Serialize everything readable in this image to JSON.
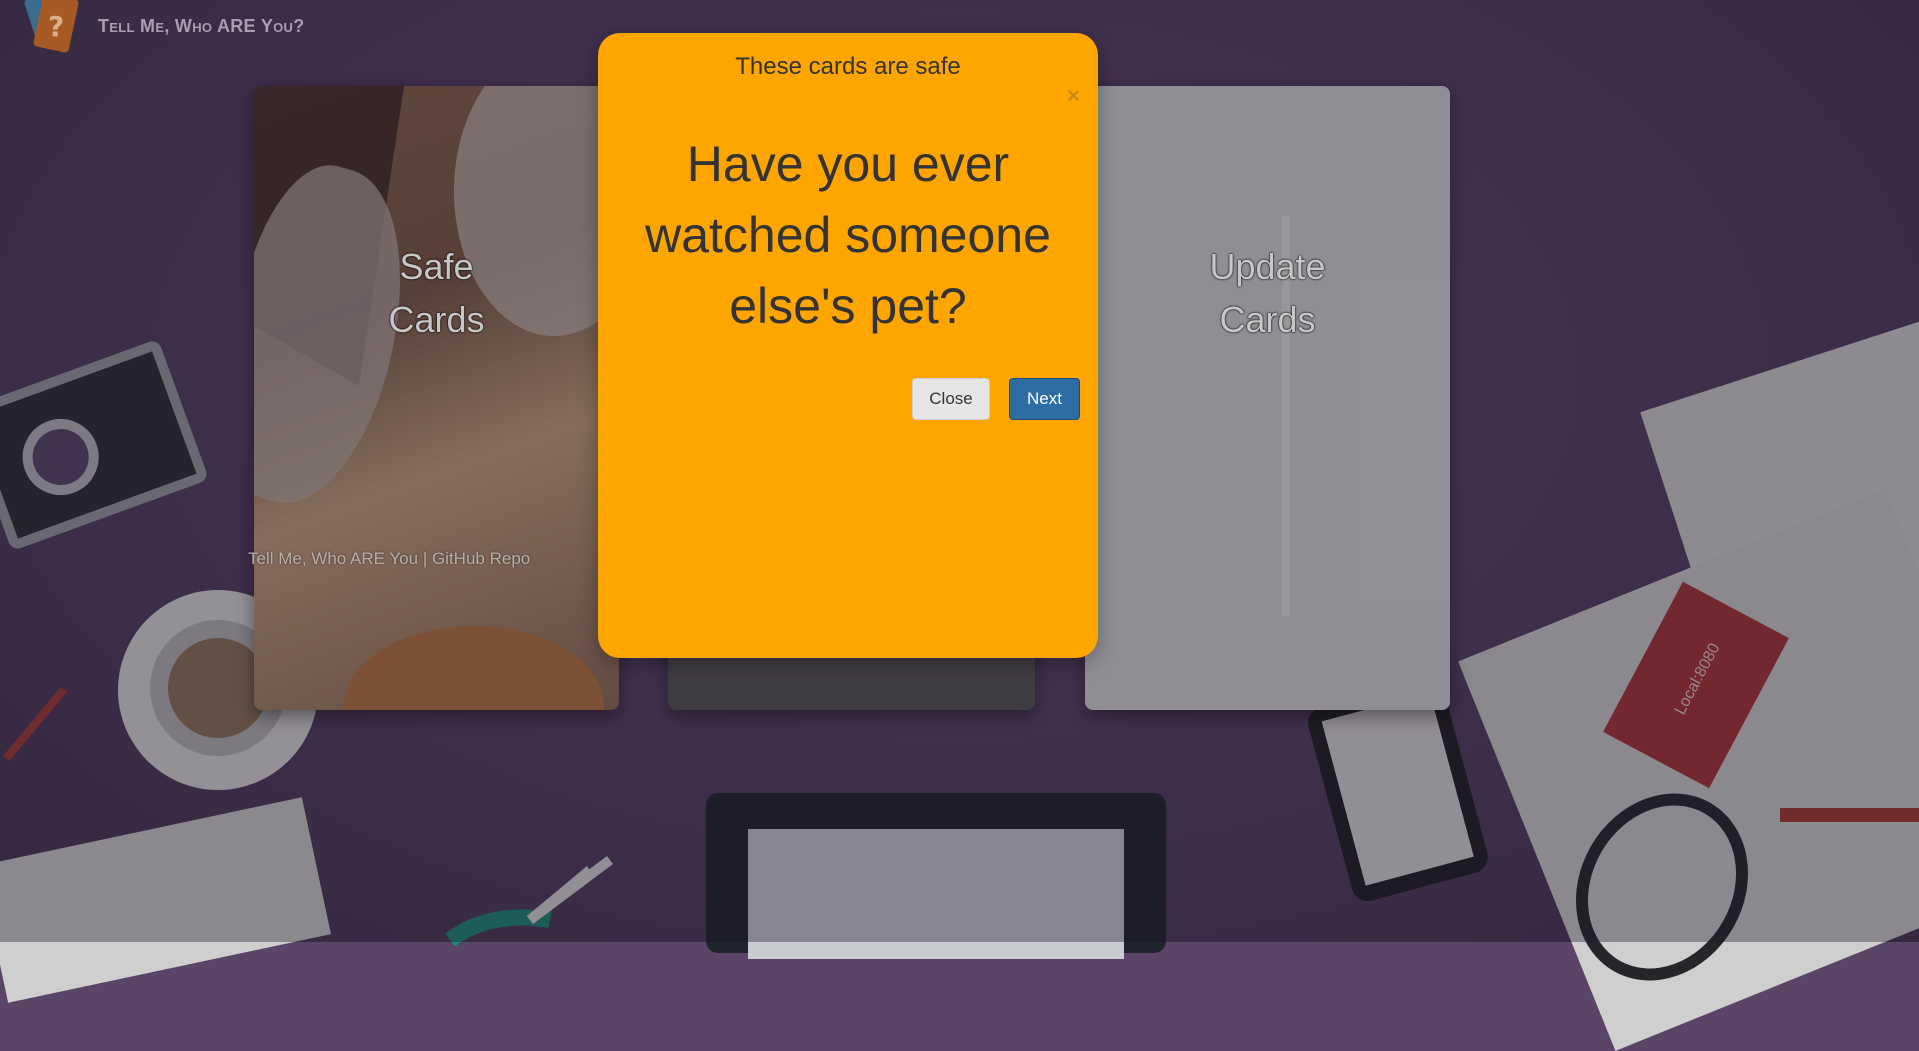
{
  "header": {
    "brand": "Tell Me, Who ARE You?"
  },
  "cards": {
    "safe": {
      "title_line1": "Safe",
      "title_line2": "Cards",
      "link": "Tell Me, Who ARE You | GitHub Repo"
    },
    "update": {
      "title_line1": "Update",
      "title_line2": "Cards"
    }
  },
  "modal": {
    "header": "These cards are safe",
    "close_x": "×",
    "question": "Have you ever watched someone else's pet?",
    "close_button": "Close",
    "next_button": "Next"
  },
  "decor": {
    "ticket_text": "Local:8080",
    "colors": {
      "modal_bg": "#ffa500",
      "next_btn": "#2e6da4",
      "desk_bg": "#5a4468"
    }
  }
}
